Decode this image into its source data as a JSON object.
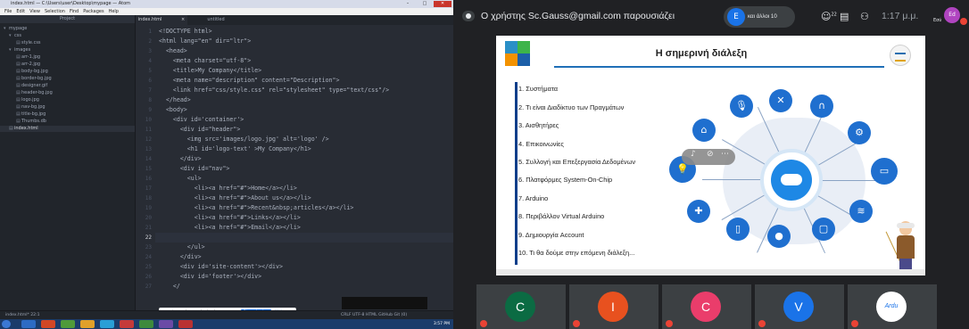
{
  "editor": {
    "title": "index.html — C:\\Users\\user\\Desktop\\mypage — Atom",
    "window_controls": {
      "minimize": "–",
      "maximize": "□",
      "close": "✕"
    },
    "menu": [
      "File",
      "Edit",
      "View",
      "Selection",
      "Find",
      "Packages",
      "Help"
    ],
    "tree_header": "Project",
    "tree": [
      {
        "label": "mypage",
        "icon": "folder-open-icon"
      },
      {
        "label": "css",
        "icon": "folder-open-icon"
      },
      {
        "label": "style.css",
        "icon": "file-icon"
      },
      {
        "label": "images",
        "icon": "folder-open-icon"
      },
      {
        "label": "arr-1.jpg",
        "icon": "file-icon"
      },
      {
        "label": "arr-2.jpg",
        "icon": "file-icon"
      },
      {
        "label": "body-bg.jpg",
        "icon": "file-icon"
      },
      {
        "label": "border-bg.jpg",
        "icon": "file-icon"
      },
      {
        "label": "designer.gif",
        "icon": "file-icon"
      },
      {
        "label": "header-bg.jpg",
        "icon": "file-icon"
      },
      {
        "label": "logo.jpg",
        "icon": "file-icon"
      },
      {
        "label": "nav-bg.jpg",
        "icon": "file-icon"
      },
      {
        "label": "title-bg.jpg",
        "icon": "file-icon"
      },
      {
        "label": "Thumbs.db",
        "icon": "file-icon"
      },
      {
        "label": "index.html",
        "icon": "file-icon"
      }
    ],
    "tabs": [
      "index.html",
      "untitled"
    ],
    "tab_close": "×",
    "line_numbers": [
      "1",
      "2",
      "3",
      "4",
      "5",
      "6",
      "7",
      "8",
      "9",
      "10",
      "11",
      "12",
      "13",
      "14",
      "15",
      "16",
      "17",
      "18",
      "19",
      "20",
      "21",
      "22",
      "23",
      "24",
      "25",
      "26",
      "27"
    ],
    "code": [
      "<!DOCTYPE html>",
      "<html lang=\"en\" dir=\"ltr\">",
      "  <head>",
      "    <meta charset=\"utf-8\">",
      "    <title>My Company</title>",
      "    <meta name=\"description\" content=\"Description\">",
      "    <link href=\"css/style.css\" rel=\"stylesheet\" type=\"text/css\"/>",
      "  </head>",
      "  <body>",
      "    <div id='container'>",
      "      <div id=\"header\">",
      "        <img src='images/logo.jpg' alt='logo' />",
      "        <h1 id='logo-text' >My Company</h1>",
      "      </div>",
      "      <div id=\"nav\">",
      "        <ul>",
      "          <li><a href=\"#\">Home</a></li>",
      "          <li><a href=\"#\">About us</a></li>",
      "          <li><a href=\"#\">Recent&nbsp;articles</a></li>",
      "          <li><a href=\"#\">Links</a></li>",
      "          <li><a href=\"#\">Email</a></li>",
      "",
      "        </ul>",
      "      </div>",
      "      <div id='site-content'></div>",
      "      <div id='footer'></div>",
      "    </"
    ],
    "share_bar": {
      "message": "meet.google.com is sharing your screen.",
      "stop": "Stop sharing",
      "hide": "Hide"
    },
    "status_left": "index.html*   22:1",
    "status_right": "CRLF   UTF-8   HTML   GitHub   Git (0)",
    "clock": "3:57 PM"
  },
  "meet": {
    "presenter_text": "Ο χρήστης Sc.Gauss@gmail.com παρουσιάζει",
    "others_avatar": "E",
    "others_label": "και άλλοι 10",
    "people_count": "22",
    "time": "1:17 μ.μ.",
    "self_avatar": "Ed",
    "self_label": "Εσύ",
    "slide": {
      "title": "Η σημερινή διάλεξη",
      "agenda": [
        "1.  Συστήματα",
        "2.  Τι είναι Διαδίκτυο των Πραγμάτων",
        "3.  Αισθητήρες",
        "4.  Επικοινωνίες",
        "5.  Συλλογή και Επεξεργασία Δεδομένων",
        "6.  Πλατφόρμες System-On-Chip",
        "7.  Arduino",
        "8.  Περιβάλλον Virtual Arduino",
        "9.  Δημιουργία Account",
        "10. Τι θα δούμε στην επόμενη διάλεξη..."
      ]
    },
    "participants": [
      {
        "initial": "C",
        "color": "#0b6b43"
      },
      {
        "initial": "I",
        "color": "#e8511f"
      },
      {
        "initial": "C",
        "color": "#ea3d6b"
      },
      {
        "initial": "V",
        "color": "#1a73e8"
      },
      {
        "initial": "Ardu",
        "color": "#ffffff"
      }
    ]
  }
}
